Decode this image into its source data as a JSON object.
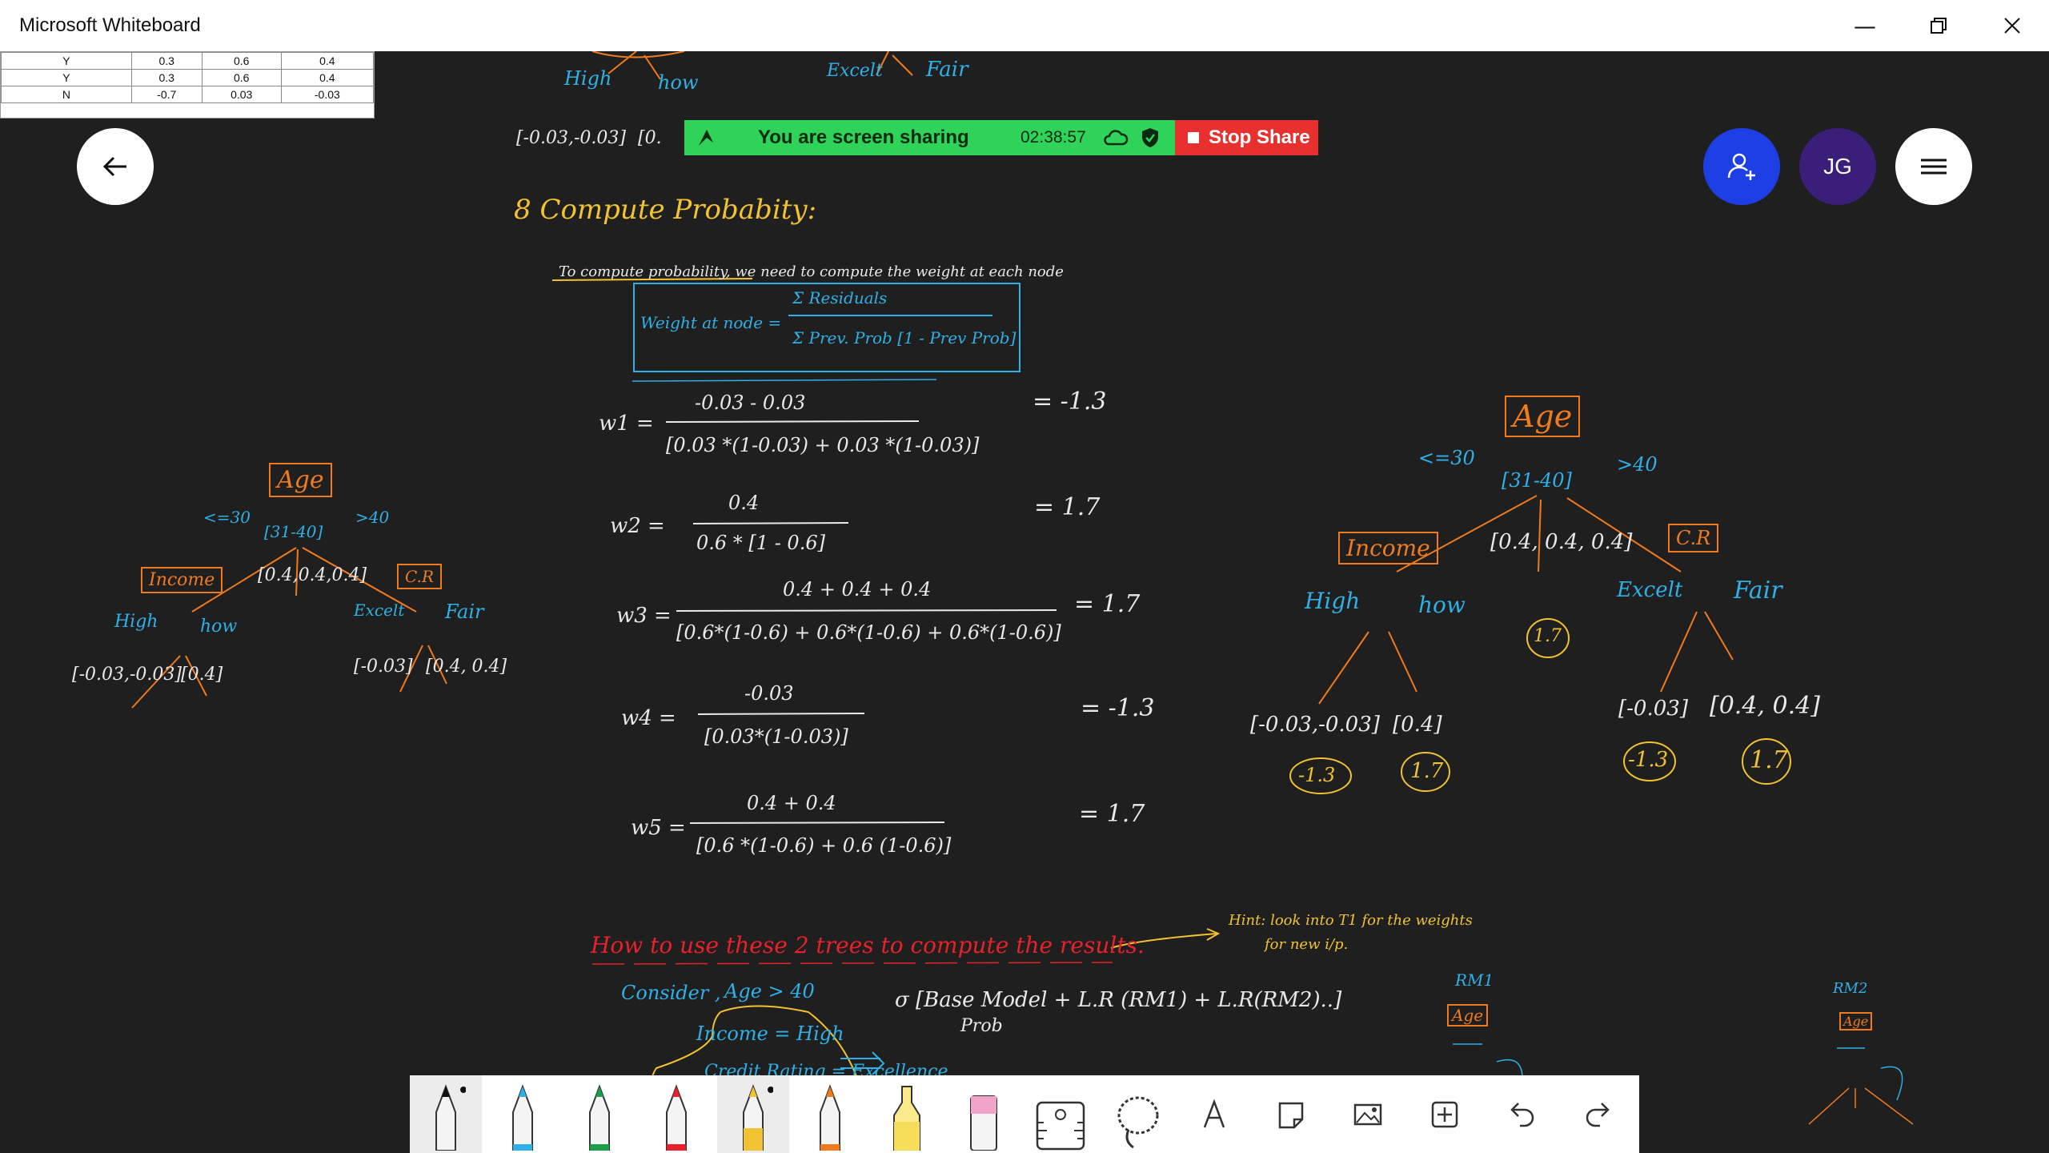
{
  "window": {
    "title": "Microsoft Whiteboard",
    "minimize_icon": "minimize-icon",
    "restore_icon": "restore-icon",
    "close_icon": "close-icon"
  },
  "table_snippet": {
    "rows": [
      [
        "Y",
        "0.3",
        "0.6",
        "0.4"
      ],
      [
        "Y",
        "0.3",
        "0.6",
        "0.4"
      ],
      [
        "N",
        "-0.7",
        "0.03",
        "-0.03"
      ]
    ]
  },
  "share": {
    "status": "You are screen sharing",
    "timer": "02:38:57",
    "stop_label": "Stop Share"
  },
  "top_right": {
    "avatar_initials": "JG"
  },
  "colors": {
    "orange": "#f07b1e",
    "blue": "#2fb0e6",
    "yellow": "#f1c232",
    "red": "#e8212a",
    "white": "#e9e9e9",
    "share_green": "#2fd35a",
    "stop_red": "#e8312f",
    "invite_blue": "#1f3fe6",
    "avatar_purple": "#3b1d7a"
  },
  "notes": {
    "top_high": "High",
    "top_low": "how",
    "top_excl": "Excelt",
    "top_fair": "Fair",
    "top_leaf_a": "[-0.03,-0.03]",
    "top_leaf_b": "[0.",
    "section_title": "8 Compute Probabity:",
    "intro": "To compute probability, we need to compute the weight at each node",
    "formula_left": "Weight at node =",
    "formula_num": "Σ Residuals",
    "formula_den": "Σ Prev. Prob [1 - Prev Prob]",
    "w1_label": "w1 =",
    "w1_num": "-0.03 - 0.03",
    "w1_den": "[0.03 *(1-0.03) + 0.03 *(1-0.03)]",
    "w1_res": "= -1.3",
    "w2_label": "w2 =",
    "w2_num": "0.4",
    "w2_den": "0.6 * [1 - 0.6]",
    "w2_res": "= 1.7",
    "w3_label": "w3 =",
    "w3_num": "0.4 + 0.4 + 0.4",
    "w3_den": "[0.6*(1-0.6) + 0.6*(1-0.6) + 0.6*(1-0.6)]",
    "w3_res": "= 1.7",
    "w4_label": "w4 =",
    "w4_num": "-0.03",
    "w4_den": "[0.03*(1-0.03)]",
    "w4_res": "= -1.3",
    "w5_label": "w5 =",
    "w5_num": "0.4 + 0.4",
    "w5_den": "[0.6 *(1-0.6) + 0.6 (1-0.6)]",
    "w5_res": "= 1.7",
    "how_to": "How to use these 2 trees to compute the results.",
    "hint_1": "Hint: look into T1 for the weights",
    "hint_2": "for new i/p.",
    "consider": "Consider ,",
    "age_cond": "Age > 40",
    "income_cond": "Income = High",
    "credit_cond": "Credit Rating = Excellence",
    "sigma_expr": "σ [Base Model + L.R (RM1) + L.R(RM2)..]",
    "prob": "Prob"
  },
  "tree_left": {
    "root": "Age",
    "lt30": "<=30",
    "mid": "[31-40]",
    "gt40": ">40",
    "income": "Income",
    "mid_leaf": "[0.4,0.4,0.4]",
    "credit": "C.R",
    "high": "High",
    "low": "how",
    "excl": "Excelt",
    "fair": "Fair",
    "leaf1": "[-0.03,-0.03]",
    "leaf2": "[0.4]",
    "leaf3": "[-0.03]",
    "leaf4": "[0.4, 0.4]"
  },
  "tree_right": {
    "root": "Age",
    "lt30": "<=30",
    "mid": "[31-40]",
    "gt40": ">40",
    "income": "Income",
    "mid_leaf": "[0.4, 0.4, 0.4]",
    "credit": "C.R",
    "high": "High",
    "low": "how",
    "excl": "Excelt",
    "fair": "Fair",
    "leaf1": "[-0.03,-0.03]",
    "leaf2": "[0.4]",
    "leaf3": "[-0.03]",
    "leaf4": "[0.4, 0.4]",
    "w_mid": "1.7",
    "w1": "-1.3",
    "w2": "1.7",
    "w3": "-1.3",
    "w4": "1.7"
  },
  "mini_trees": {
    "rm1": "RM1",
    "rm2": "RM2",
    "age": "Age"
  },
  "toolbar": {
    "tools": [
      "pen-black",
      "pen-blue",
      "pen-green",
      "pen-red",
      "pen-yellow",
      "pen-orange",
      "highlighter-yellow",
      "highlighter-pink",
      "eraser",
      "lasso",
      "text",
      "sticky-note",
      "image",
      "add",
      "undo",
      "redo"
    ]
  }
}
